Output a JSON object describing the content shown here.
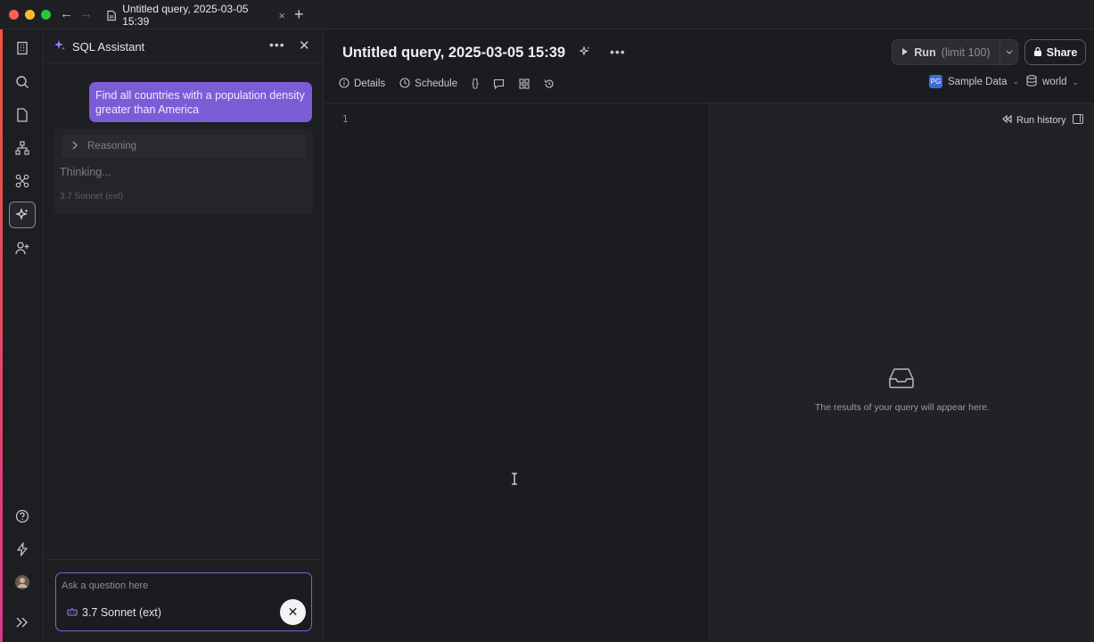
{
  "window": {
    "tab_title": "Untitled query, 2025-03-05 15:39",
    "tab_close": "×",
    "new_tab": "+",
    "back": "←",
    "forward": "→"
  },
  "rail": {
    "icons": [
      "building-icon",
      "search-icon",
      "document-icon",
      "hierarchy-icon",
      "integrations-icon",
      "sparkle-icon",
      "add-user-icon",
      "help-icon",
      "lightning-icon",
      "avatar",
      "expand-icon"
    ]
  },
  "assistant": {
    "title": "SQL Assistant",
    "more": "•••",
    "close": "✕",
    "user_message": "Find all countries with a population density greater than America",
    "reasoning_label": "Reasoning",
    "thinking": "Thinking...",
    "model_tag": "3.7 Sonnet (ext)",
    "input_placeholder": "Ask a question here",
    "selected_model": "3.7 Sonnet (ext)",
    "stop": "✕"
  },
  "query": {
    "title": "Untitled query, 2025-03-05 15:39",
    "more": "•••",
    "run_label": "Run",
    "run_limit": "(limit 100)",
    "share_label": "Share",
    "toolbar": {
      "details": "Details",
      "schedule": "Schedule",
      "braces": "{}"
    },
    "datasource": "Sample Data",
    "database": "world",
    "line_number": "1"
  },
  "results": {
    "run_history": "Run history",
    "empty_message": "The results of your query will appear here."
  },
  "colors": {
    "accent_purple": "#7c5cd6",
    "background": "#1b1c1f"
  }
}
